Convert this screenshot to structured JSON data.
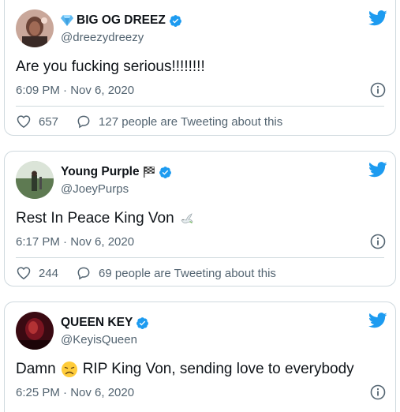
{
  "tweets": [
    {
      "display_name": "BIG OG DREEZ",
      "name_prefix_icon": "diamond-icon",
      "handle": "@dreezydreezy",
      "text": "Are you fucking serious!!!!!!!!",
      "timestamp": "6:09 PM · Nov 6, 2020",
      "likes": "657",
      "discussion": "127 people are Tweeting about this"
    },
    {
      "display_name": "Young Purple",
      "name_suffix_icon": "checkered-flag-icon",
      "handle": "@JoeyPurps",
      "text": "Rest In Peace King Von",
      "text_emoji": "dove-icon",
      "timestamp": "6:17 PM · Nov 6, 2020",
      "likes": "244",
      "discussion": "69 people are Tweeting about this"
    },
    {
      "display_name": "QUEEN KEY",
      "handle": "@KeyisQueen",
      "text_before": "Damn",
      "text_emoji": "disappointed-face-icon",
      "text_after": "RIP King Von, sending love to everybody",
      "timestamp": "6:25 PM · Nov 6, 2020"
    }
  ],
  "colors": {
    "twitter_blue": "#1d9bf0",
    "text_primary": "#0f1419",
    "text_secondary": "#536471",
    "border": "#cfd9de"
  }
}
